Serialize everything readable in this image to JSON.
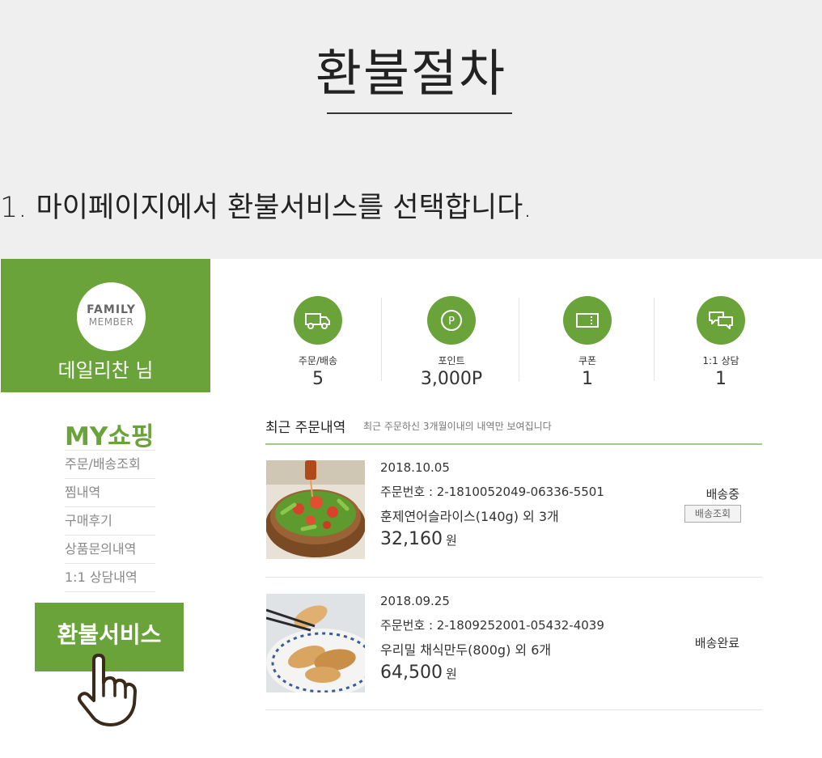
{
  "header": {
    "title": "환불절차",
    "step": "1. 마이페이지에서 환불서비스를 선택합니다."
  },
  "member": {
    "badge_line1": "FAMILY",
    "badge_line2": "MEMBER",
    "name": "데일리찬 님"
  },
  "sidebar": {
    "title": "MY쇼핑",
    "items": [
      {
        "label": "주문/배송조회"
      },
      {
        "label": "찜내역"
      },
      {
        "label": "구매후기"
      },
      {
        "label": "상품문의내역"
      },
      {
        "label": "1:1 상담내역"
      }
    ],
    "refund_button": "환불서비스"
  },
  "stats": [
    {
      "label": "주문/배송",
      "value": "5",
      "icon": "truck-icon"
    },
    {
      "label": "포인트",
      "value": "3,000P",
      "icon": "point-icon"
    },
    {
      "label": "쿠폰",
      "value": "1",
      "icon": "coupon-icon"
    },
    {
      "label": "1:1 상담",
      "value": "1",
      "icon": "chat-bubbles-icon"
    }
  ],
  "orders": {
    "title": "최근 주문내역",
    "subtitle": "최근 주문하신 3개월이내의 내역만 보여집니다",
    "list": [
      {
        "date": "2018.10.05",
        "number": "주문번호 : 2-1810052049-06336-5501",
        "item": "훈제연어슬라이스(140g) 외 3개",
        "price": "32,160",
        "currency": "원",
        "status": "배송중",
        "track_button": "배송조회"
      },
      {
        "date": "2018.09.25",
        "number": "주문번호 : 2-1809252001-05432-4039",
        "item": "우리밀 채식만두(800g) 외 6개",
        "price": "64,500",
        "currency": "원",
        "status": "배송완료"
      }
    ]
  },
  "colors": {
    "accent": "#6aa33a",
    "background": "#efefef",
    "divider": "#a3c98a"
  }
}
